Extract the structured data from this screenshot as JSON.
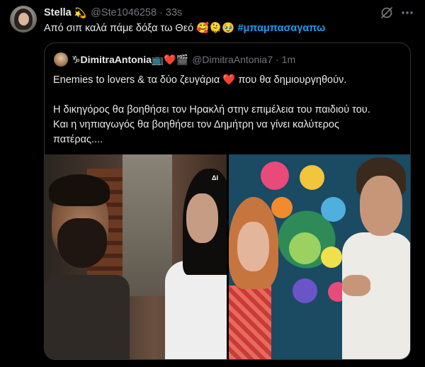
{
  "tweet": {
    "author_name": "Stella",
    "author_badge": "💫",
    "handle": "@Ste1046258",
    "separator": "·",
    "time": "33s",
    "text_plain": "Από σιπ καλά πάμε δόξα τω Θεό 🥰🫠🥹 ",
    "hashtag": "#μπαμπασαγαπω"
  },
  "quote": {
    "author_name": "♑DimitraAntonia📺❤️🎬",
    "handle": "@DimitraAntonia7",
    "separator": "·",
    "time": "1m",
    "lines": [
      "Enemies to lovers & τα δύο ζευγάρια ❤️ που θα δημιουργηθούν.",
      "",
      "Η δικηγόρος θα βοηθήσει τον Ηρακλή στην επιμέλεια του παιδιού του.",
      "Και η νηπιαγωγός θα βοηθήσει τον Δημήτρη να γίνει καλύτερος",
      "πατέρας...."
    ],
    "image_tag": "ΔΙ"
  },
  "icons": {
    "grok": "grok-icon",
    "more": "more-icon"
  },
  "colors": {
    "background": "#000000",
    "text": "#e7e9ea",
    "muted": "#71767b",
    "link": "#1d9bf0",
    "border": "#2f3336"
  }
}
